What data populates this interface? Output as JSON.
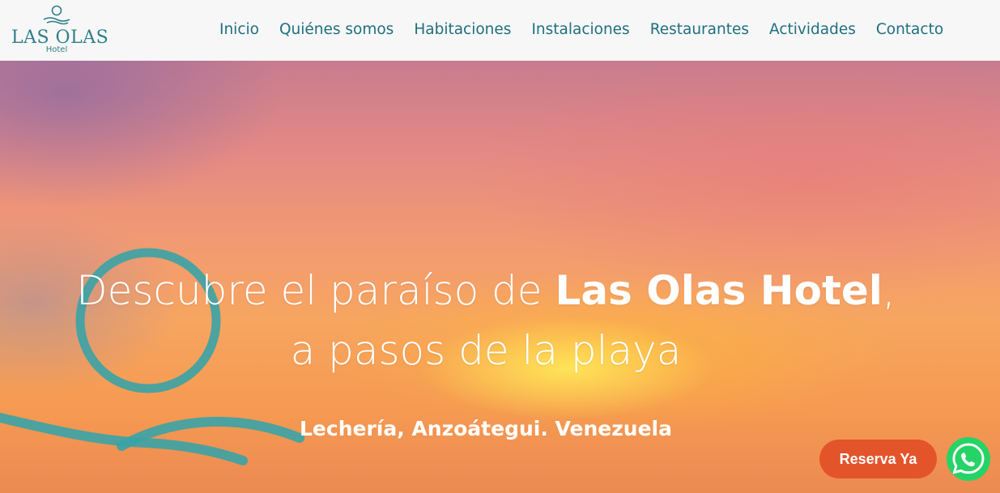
{
  "brand": {
    "name": "LAS OLAS",
    "sub": "Hotel",
    "color": "#2e7f8a"
  },
  "nav": {
    "items": [
      {
        "label": "Inicio"
      },
      {
        "label": "Quiénes somos"
      },
      {
        "label": "Habitaciones"
      },
      {
        "label": "Instalaciones"
      },
      {
        "label": "Restaurantes"
      },
      {
        "label": "Actividades"
      },
      {
        "label": "Contacto"
      }
    ],
    "color": "#1f6f80"
  },
  "hero": {
    "title_pre": "Descubre el paraíso de ",
    "title_bold": "Las Olas Hotel",
    "title_post": ",",
    "title_line2": "a pasos de la playa",
    "subtitle": "Lechería, Anzoátegui. Venezuela",
    "deco_color": "#3aa3a6"
  },
  "cta": {
    "reserve_label": "Reserva Ya",
    "reserve_color": "#e4542a",
    "whatsapp_icon": "whatsapp-icon",
    "whatsapp_color": "#25d366"
  }
}
